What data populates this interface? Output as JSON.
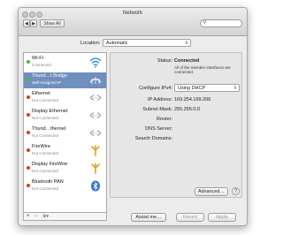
{
  "window": {
    "title": "Network",
    "show_all": "Show All",
    "nav_back": "◀",
    "nav_forward": "▶"
  },
  "location": {
    "label": "Location:",
    "value": "Automatic"
  },
  "services": [
    {
      "name": "Wi-Fi",
      "status": "Connected",
      "dot": "green",
      "icon": "wifi-icon",
      "selected": false
    },
    {
      "name": "Thund…t Bridge",
      "status": "Self-Assigned IP",
      "dot": "green",
      "icon": "bridge-icon",
      "selected": true
    },
    {
      "name": "Ethernet",
      "status": "Not Connected",
      "dot": "red",
      "icon": "ethernet-icon",
      "selected": false
    },
    {
      "name": "Display Ethernet",
      "status": "Not Connected",
      "dot": "red",
      "icon": "ethernet-icon",
      "selected": false
    },
    {
      "name": "Thund…thernet",
      "status": "Not Connected",
      "dot": "red",
      "icon": "ethernet-icon",
      "selected": false
    },
    {
      "name": "FireWire",
      "status": "Not Connected",
      "dot": "red",
      "icon": "firewire-icon",
      "selected": false
    },
    {
      "name": "Display FireWire",
      "status": "Not Connected",
      "dot": "red",
      "icon": "firewire-icon",
      "selected": false
    },
    {
      "name": "Bluetooth PAN",
      "status": "Not Connected",
      "dot": "red",
      "icon": "bluetooth-icon",
      "selected": false
    }
  ],
  "sidebar_controls": {
    "add": "+",
    "remove": "−",
    "action": "⚙▾"
  },
  "details": {
    "status_label": "Status:",
    "status_value": "Connected",
    "status_note": "All of the member interfaces are connected.",
    "configure_label": "Configure IPv4:",
    "configure_value": "Using DHCP",
    "ip_label": "IP Address:",
    "ip_value": "169.254.169.206",
    "subnet_label": "Subnet Mask:",
    "subnet_value": "255.255.0.0",
    "router_label": "Router:",
    "dns_label": "DNS Server:",
    "search_label": "Search Domains:",
    "advanced": "Advanced…",
    "help": "?"
  },
  "footer": {
    "assist": "Assist me…",
    "revert": "Revert",
    "apply": "Apply"
  },
  "colors": {
    "selection": "#6f8fbe",
    "connected_dot": "#3dbb3d",
    "disconnected_dot": "#d43b2b",
    "wifi": "#3b8fd9",
    "firewire": "#e0a21a",
    "bluetooth": "#2f6fd6"
  }
}
